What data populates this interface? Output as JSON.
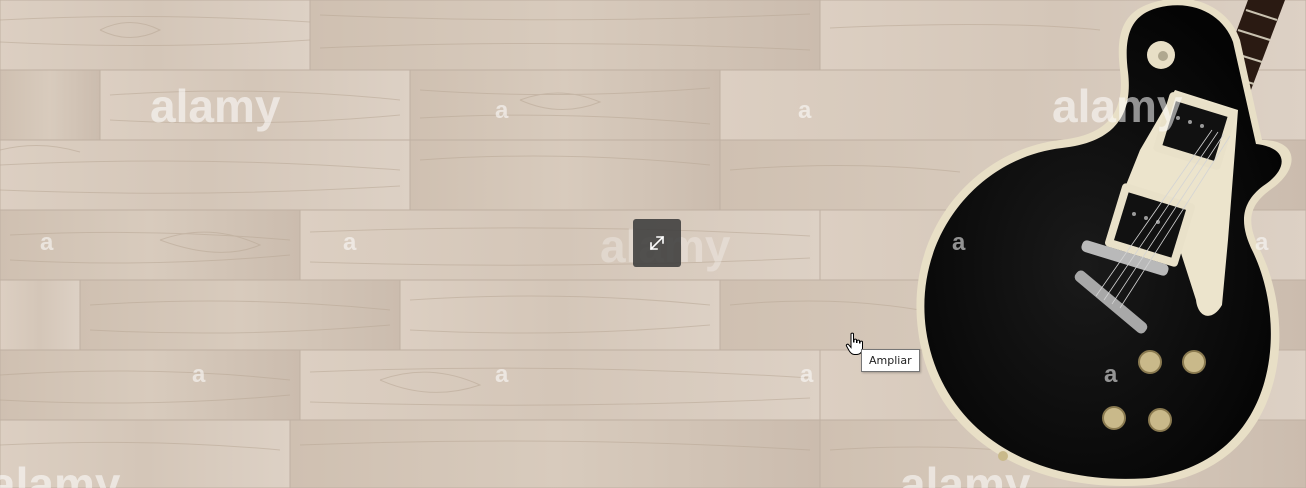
{
  "viewer": {
    "watermark_text": "alamy",
    "watermark_mark": "a",
    "expand_button": {
      "icon": "expand-icon"
    },
    "tooltip": {
      "text": "Ampliar"
    },
    "cursor": {
      "icon": "hand-pointer-cursor"
    }
  },
  "colors": {
    "wood_base": "#d9ccbf",
    "guitar_body": "#0a0a0a",
    "guitar_binding": "#e8dfc6",
    "button_bg": "#3c3c3c"
  }
}
